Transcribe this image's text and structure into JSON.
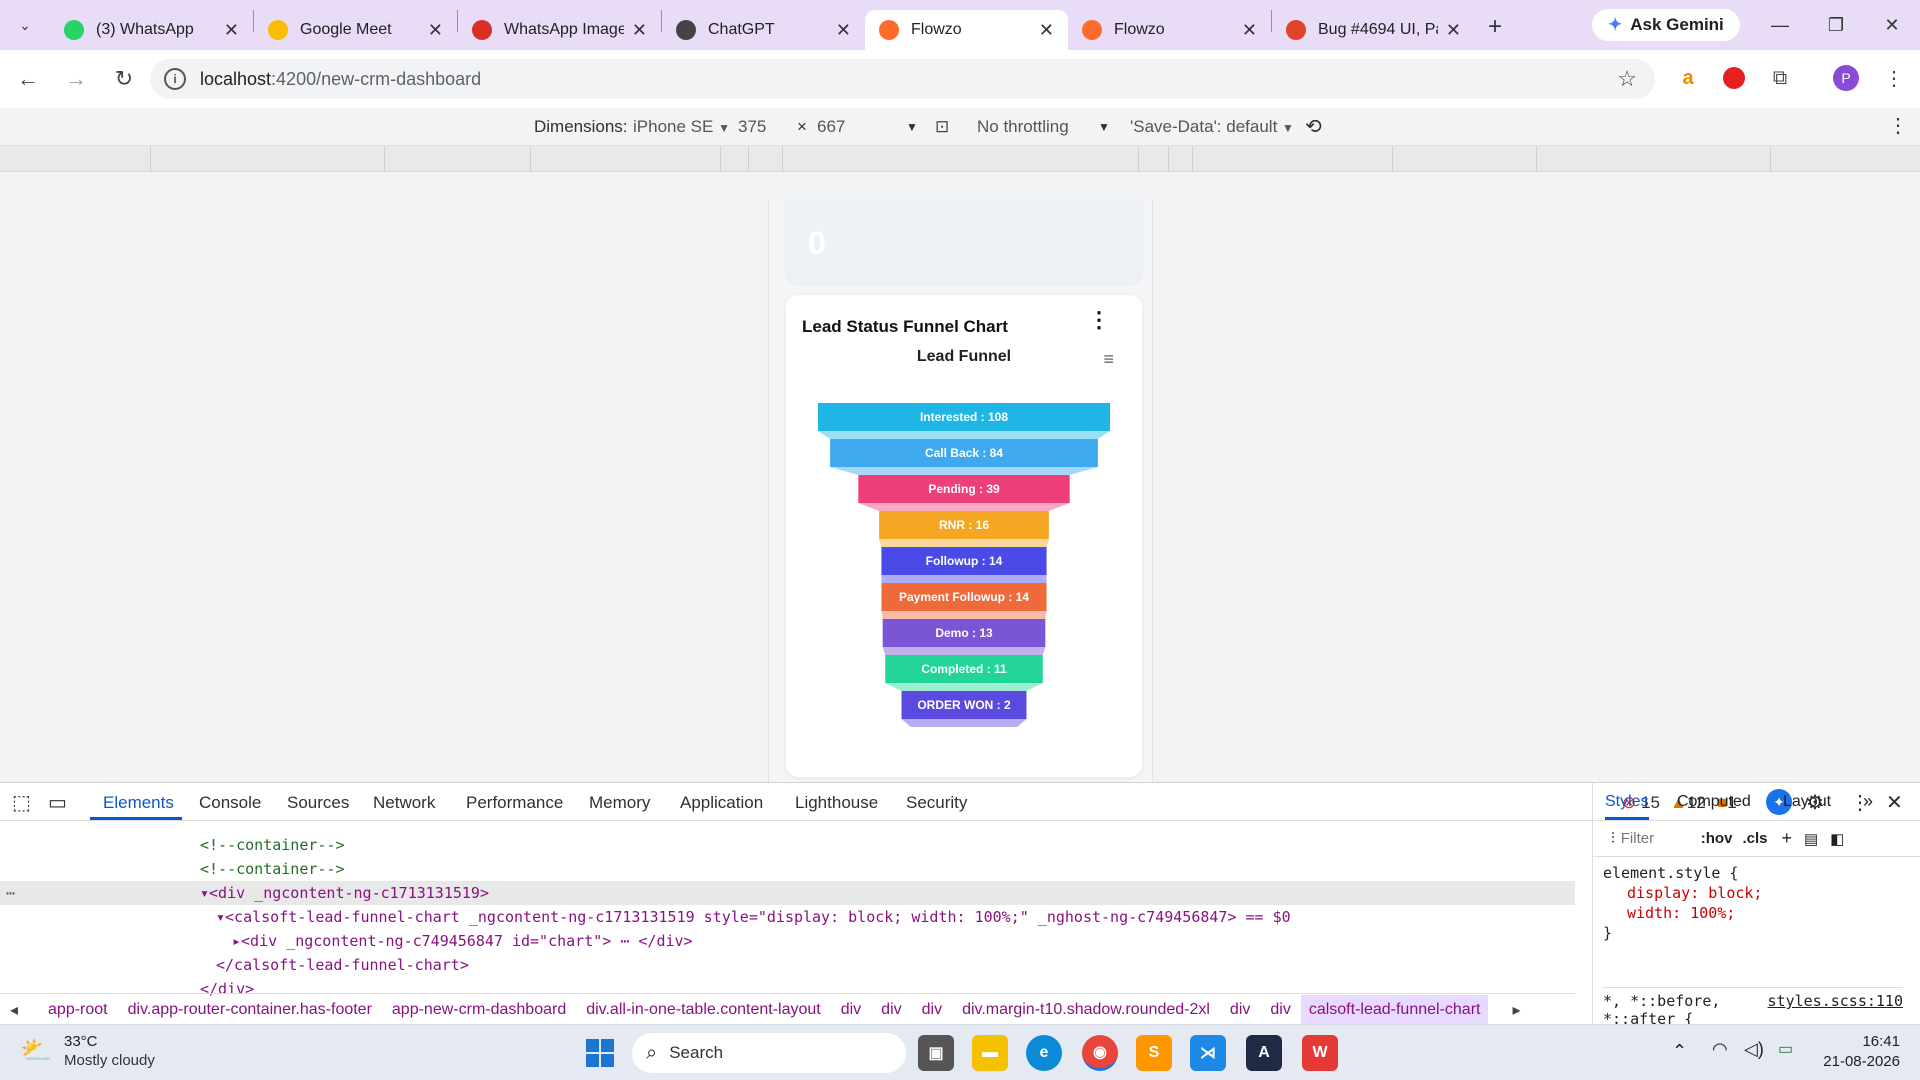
{
  "browser": {
    "tabs": [
      {
        "label": "(3) WhatsApp",
        "icon": "whatsapp-icon",
        "color": "#25d366"
      },
      {
        "label": "Google Meet",
        "icon": "google-meet-icon",
        "color": "#fbbc04"
      },
      {
        "label": "WhatsApp Image",
        "icon": "whatsapp-image-icon",
        "color": "#d93025"
      },
      {
        "label": "ChatGPT",
        "icon": "chatgpt-icon",
        "color": "#444444"
      },
      {
        "label": "Flowzo",
        "icon": "flowzo-icon",
        "color": "#ff6b2b"
      },
      {
        "label": "Flowzo",
        "icon": "flowzo-icon",
        "color": "#ff6b2b"
      },
      {
        "label": "Bug #4694 UI, Pa",
        "icon": "gitlab-icon",
        "color": "#e24329"
      }
    ],
    "active_tab_index": 4,
    "gemini_label": "Ask Gemini",
    "url_host": "localhost",
    "url_path": ":4200/new-crm-dashboard",
    "profile_initial": "P"
  },
  "device_toolbar": {
    "dimensions_label": "Dimensions:",
    "device": "iPhone SE",
    "width": "375",
    "x": "×",
    "height": "667",
    "throttling": "No throttling",
    "save_data": "'Save-Data': default"
  },
  "page": {
    "top_card_value": "0",
    "card_title": "Lead Status Funnel Chart",
    "more_icon": "⋮",
    "menu_icon": "≡"
  },
  "chart_data": {
    "type": "funnel",
    "title": "Lead Funnel",
    "stages": [
      {
        "name": "Interested",
        "value": 108,
        "color": "#1fb6e6"
      },
      {
        "name": "Call Back",
        "value": 84,
        "color": "#3fa9f0"
      },
      {
        "name": "Pending",
        "value": 39,
        "color": "#ee3f7a"
      },
      {
        "name": "RNR",
        "value": 16,
        "color": "#f5a623"
      },
      {
        "name": "Followup",
        "value": 14,
        "color": "#4a4ae8"
      },
      {
        "name": "Payment Followup",
        "value": 14,
        "color": "#ef6a3a"
      },
      {
        "name": "Demo",
        "value": 13,
        "color": "#7a55d4"
      },
      {
        "name": "Completed",
        "value": 11,
        "color": "#22d49a"
      },
      {
        "name": "ORDER WON",
        "value": 2,
        "color": "#5b4ae0"
      }
    ]
  },
  "devtools": {
    "tabs": [
      "Elements",
      "Console",
      "Sources",
      "Network",
      "Performance",
      "Memory",
      "Application",
      "Lighthouse",
      "Security"
    ],
    "errors": "15",
    "warnings": "12",
    "issues": "1",
    "code_lines": [
      {
        "indent": 0,
        "text": "<!--container-->",
        "kind": "comment"
      },
      {
        "indent": 0,
        "text": "<!--container-->",
        "kind": "comment"
      },
      {
        "indent": 0,
        "text": "▾<div _ngcontent-ng-c1713131519>",
        "kind": "tag"
      },
      {
        "indent": 1,
        "text": "▾<calsoft-lead-funnel-chart _ngcontent-ng-c1713131519 style=\"display: block; width: 100%;\" _nghost-ng-c749456847> == $0",
        "kind": "selected"
      },
      {
        "indent": 2,
        "text": "▸<div _ngcontent-ng-c749456847 id=\"chart\"> ⋯ </div>",
        "kind": "tag"
      },
      {
        "indent": 1,
        "text": "</calsoft-lead-funnel-chart>",
        "kind": "tag"
      },
      {
        "indent": 0,
        "text": "</div>",
        "kind": "tag"
      }
    ],
    "breadcrumbs": [
      "app-root",
      "div.app-router-container.has-footer",
      "app-new-crm-dashboard",
      "div.all-in-one-table.content-layout",
      "div",
      "div",
      "div",
      "div.margin-t10.shadow.rounded-2xl",
      "div",
      "div",
      "calsoft-lead-funnel-chart"
    ],
    "styles_tabs": [
      "Styles",
      "Computed",
      "Layout"
    ],
    "filter_placeholder": "Filter",
    "hov": ":hov",
    "cls": ".cls",
    "style_rule_selector": "element.style {",
    "style_rule_1": "display: block;",
    "style_rule_2": "width: 100%;",
    "style_rule_close": "}",
    "next_rule": "*, *::before,",
    "next_rule_2": "*::after {",
    "next_rule_source": "styles.scss:110"
  },
  "taskbar": {
    "weather_temp": "33°C",
    "weather_desc": "Mostly cloudy",
    "search_label": "Search",
    "time": "16:41",
    "date": "21-08-2026"
  }
}
